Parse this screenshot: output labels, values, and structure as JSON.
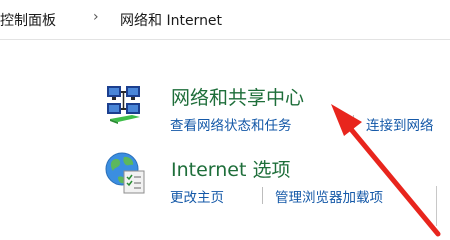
{
  "breadcrumb": {
    "items": [
      "控制面板",
      "网络和 Internet"
    ],
    "separator": "›"
  },
  "categories": [
    {
      "icon": "network-icon",
      "title": "网络和共享中心",
      "links": [
        "查看网络状态和任务",
        "连接到网络"
      ]
    },
    {
      "icon": "internet-options-icon",
      "title": "Internet 选项",
      "links": [
        "更改主页",
        "管理浏览器加载项"
      ]
    }
  ],
  "colors": {
    "category_title": "#1e6e3a",
    "link": "#1559a8",
    "annotation_arrow": "#e8251d"
  },
  "annotation": {
    "type": "red-arrow",
    "target": "查看网络状态和任务"
  }
}
